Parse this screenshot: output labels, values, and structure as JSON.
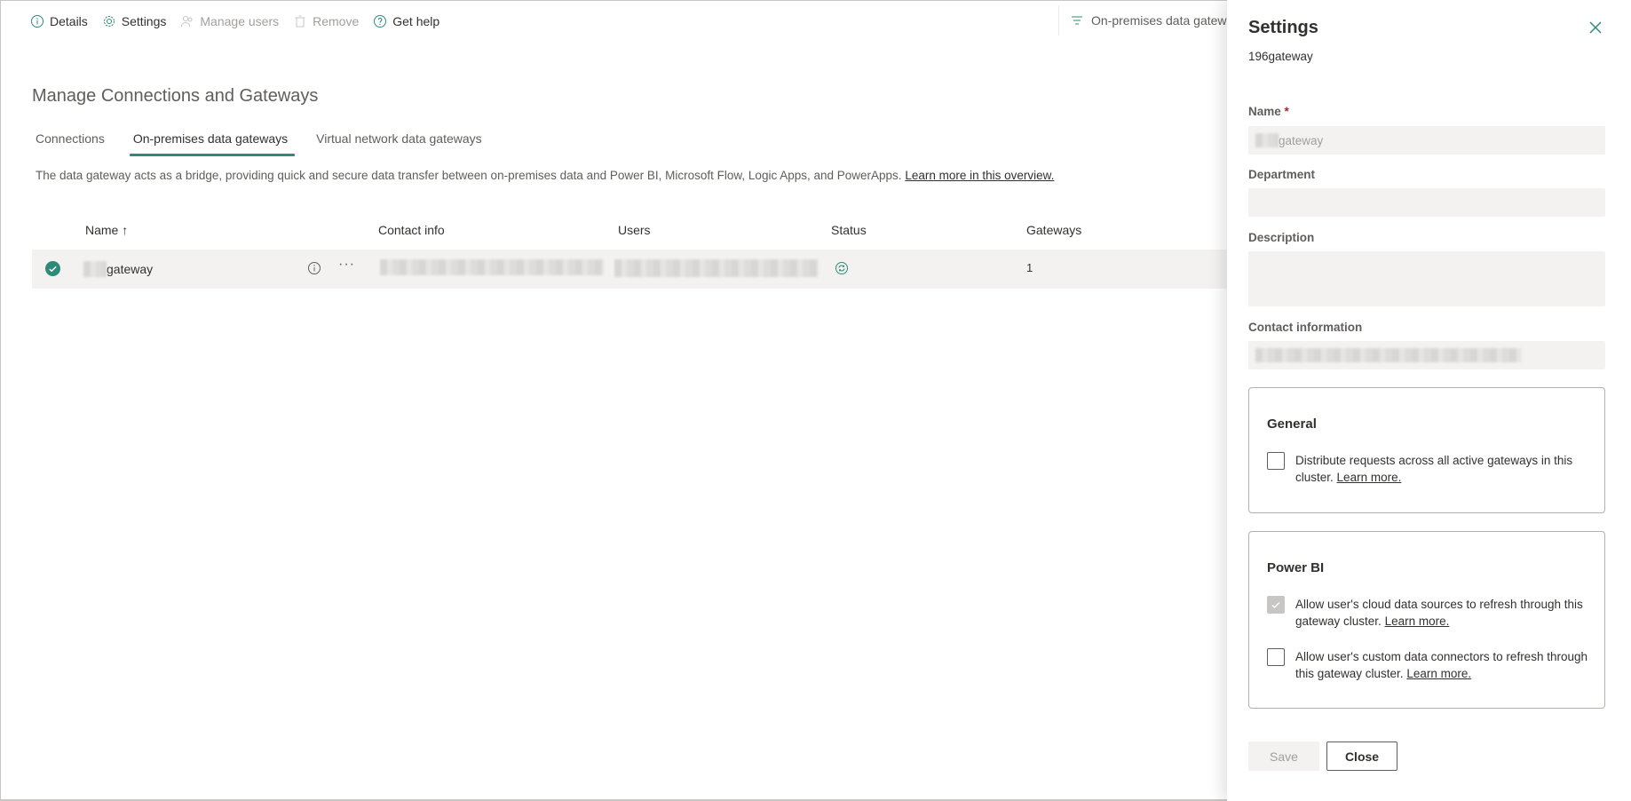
{
  "toolbar": {
    "details": "Details",
    "settings": "Settings",
    "manage_users": "Manage users",
    "remove": "Remove",
    "get_help": "Get help",
    "filter": "On-premises data gateways"
  },
  "page": {
    "title": "Manage Connections and Gateways",
    "tabs": [
      "Connections",
      "On-premises data gateways",
      "Virtual network data gateways"
    ],
    "description": "The data gateway acts as a bridge, providing quick and secure data transfer between on-premises data and Power BI, Microsoft Flow, Logic Apps, and PowerApps.",
    "learn_more": "Learn more in this overview."
  },
  "table": {
    "headers": [
      "Name ↑",
      "Contact info",
      "Users",
      "Status",
      "Gateways"
    ],
    "rows": [
      {
        "name": "gateway",
        "gateways": "1"
      }
    ]
  },
  "panel": {
    "title": "Settings",
    "subtitle": "196gateway",
    "name_label": "Name",
    "name_required": "*",
    "name_value": "gateway",
    "department_label": "Department",
    "description_label": "Description",
    "contact_label": "Contact information",
    "general": {
      "title": "General",
      "distribute": "Distribute requests across all active gateways in this cluster.",
      "learn_more": "Learn more."
    },
    "powerbi": {
      "title": "Power BI",
      "cloud_sources": "Allow user's cloud data sources to refresh through this gateway cluster.",
      "custom_connectors": "Allow user's custom data connectors to refresh through this gateway cluster.",
      "learn_more": "Learn more."
    },
    "save": "Save",
    "close": "Close"
  },
  "colors": {
    "accent": "#2e8b7a"
  }
}
